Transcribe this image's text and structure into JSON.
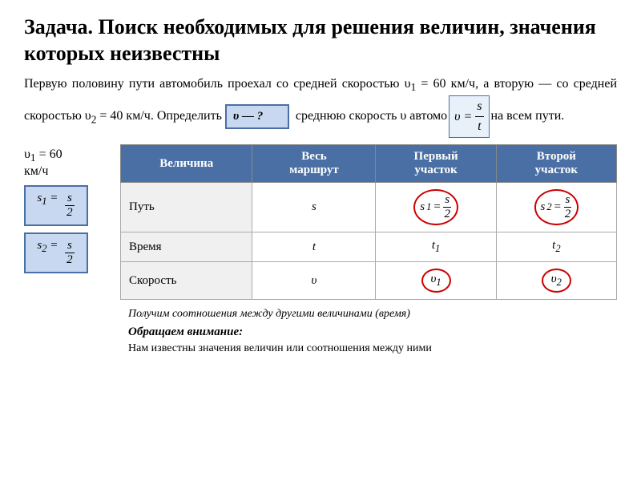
{
  "title": "Задача. Поиск необходимых для решения величин, значения которых неизвестны",
  "problem": {
    "text1": "Первую половину пути автомобиль проехал со средней скоростью υ",
    "sub1": "1",
    "text2": " = 60 км/ч, а вторую — со средней скоростью υ",
    "sub2": "2",
    "text3": " = 40 км/ч. Определить ",
    "text4": "среднюю скорость υ автомобиля на всем пути."
  },
  "unknown_label": "υ — ?",
  "v1_label": "υ₁ = 60 км/ч",
  "s1_label": "s₁ =",
  "s2_label": "s₂ =",
  "frac_s2": "s/2",
  "table": {
    "headers": [
      "Величина",
      "Весь маршрут",
      "Первый участок",
      "Второй участок"
    ],
    "rows": [
      {
        "label": "Путь",
        "col1": "s",
        "col2_oval": "s/2",
        "col2_label": "s₁ =",
        "col3_oval": "s/2",
        "col3_label": "s₂ ="
      },
      {
        "label": "Время",
        "col1": "t",
        "col2": "t₁",
        "col3": "t₂"
      },
      {
        "label": "Скорость",
        "col1": "υ",
        "col2_oval": "υ₁",
        "col3_oval": "υ₂"
      }
    ]
  },
  "bottom": {
    "line1": "Получим соотношения между другими величинами (время)",
    "line2": "Обращаем внимание:",
    "line3": "Нам известны значения величин или соотношения между ними"
  }
}
